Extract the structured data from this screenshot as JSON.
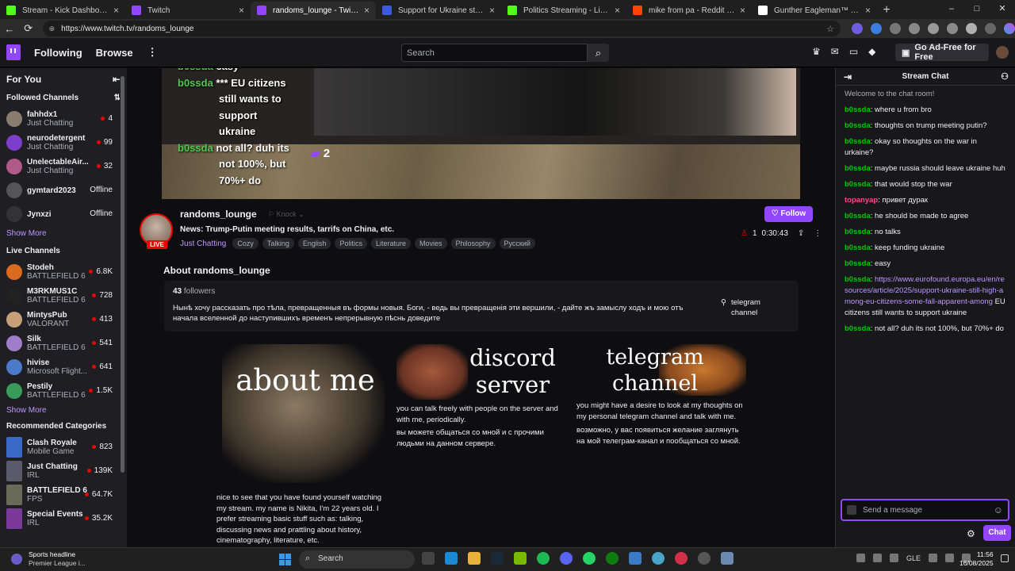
{
  "browser": {
    "tabs": [
      {
        "title": "Stream - Kick Dashboard",
        "color": "#53fc18"
      },
      {
        "title": "Twitch",
        "color": "#9147ff"
      },
      {
        "title": "randoms_lounge - Twitch",
        "color": "#9147ff"
      },
      {
        "title": "Support for Ukraine still high am",
        "color": "#3b5bdb"
      },
      {
        "title": "Politics Streaming - Live Streams",
        "color": "#53fc18"
      },
      {
        "title": "mike from pa - Reddit Search!",
        "color": "#ff4500"
      },
      {
        "title": "Gunther Eagleman™ (@Gunther",
        "color": "#ffffff"
      }
    ],
    "active_tab": 2,
    "url": "https://www.twitch.tv/randoms_lounge"
  },
  "topnav": {
    "following": "Following",
    "browse": "Browse",
    "search_placeholder": "Search",
    "adfree": "Go Ad-Free for Free"
  },
  "sidebar": {
    "for_you": "For You",
    "followed_header": "Followed Channels",
    "followed": [
      {
        "name": "fahhdx1",
        "game": "Just Chatting",
        "viewers": "4",
        "color": "#8a7d70"
      },
      {
        "name": "neurodetergent",
        "game": "Just Chatting",
        "viewers": "99",
        "color": "#7b3fc9"
      },
      {
        "name": "UnelectableAir...",
        "game": "Just Chatting",
        "viewers": "32",
        "color": "#b05a8a"
      },
      {
        "name": "gymtard2023",
        "game": "",
        "viewers": "Offline",
        "color": "#555"
      },
      {
        "name": "Jynxzi",
        "game": "",
        "viewers": "Offline",
        "color": "#333"
      }
    ],
    "show_more": "Show More",
    "live_header": "Live Channels",
    "live": [
      {
        "name": "Stodeh",
        "game": "BATTLEFIELD 6",
        "viewers": "6.8K",
        "color": "#d96a1e"
      },
      {
        "name": "M3RKMUS1C",
        "game": "BATTLEFIELD 6",
        "viewers": "728",
        "color": "#222"
      },
      {
        "name": "MintysPub",
        "game": "VALORANT",
        "viewers": "413",
        "color": "#c7a07a"
      },
      {
        "name": "Silk",
        "game": "BATTLEFIELD 6",
        "viewers": "541",
        "color": "#a07dc9"
      },
      {
        "name": "hivise",
        "game": "Microsoft Flight...",
        "viewers": "641",
        "color": "#4a7ac9"
      },
      {
        "name": "Pestily",
        "game": "BATTLEFIELD 6",
        "viewers": "1.5K",
        "color": "#3a9a5a"
      }
    ],
    "show_more2": "Show More",
    "rec_header": "Recommended Categories",
    "categories": [
      {
        "name": "Clash Royale",
        "tag": "Mobile Game",
        "viewers": "823",
        "color": "#3a6ac9"
      },
      {
        "name": "Just Chatting",
        "tag": "IRL",
        "viewers": "139K",
        "color": "#5a5a6a"
      },
      {
        "name": "BATTLEFIELD 6",
        "tag": "FPS",
        "viewers": "64.7K",
        "color": "#6a6a5a"
      },
      {
        "name": "Special Events",
        "tag": "IRL",
        "viewers": "35.2K",
        "color": "#7a3a9a"
      }
    ]
  },
  "video_overlay": {
    "lines": [
      {
        "user": "b0ssda",
        "text": "easy"
      },
      {
        "user": "b0ssda",
        "text": "*** EU citizens"
      },
      {
        "user": "",
        "text": "still wants to"
      },
      {
        "user": "",
        "text": "support"
      },
      {
        "user": "",
        "text": "ukraine"
      },
      {
        "user": "b0ssda",
        "text": "not all? duh its"
      },
      {
        "user": "",
        "text": "not 100%, but"
      },
      {
        "user": "",
        "text": "70%+ do"
      }
    ],
    "viewers_badge": "2"
  },
  "channel": {
    "name": "randoms_lounge",
    "knock": "Knock",
    "live": "LIVE",
    "title": "News: Trump-Putin meeting results, tarrifs on China, etc.",
    "category": "Just Chatting",
    "tags": [
      "Cozy",
      "Talking",
      "English",
      "Politics",
      "Literature",
      "Movies",
      "Philosophy",
      "Русский"
    ],
    "follow": "Follow",
    "viewers": "1",
    "uptime": "0:30:43"
  },
  "about": {
    "heading": "About randoms_lounge",
    "followers_count": "43",
    "followers_label": "followers",
    "bio": "Нынѣ хочу рассказать про тѣла, превращенныя въ формы новыя. Боги, - ведь вы превращенія эти вершили, - дайте жъ замыслу ходъ и мою отъ начала вселенной до наступившихъ временъ непрерывную пѣснь доведите",
    "link": "telegram channel"
  },
  "panels": {
    "p1": {
      "title": "about me",
      "text": "nice to see that you have found yourself watching my stream. my name is Nikita, I'm 22 years old. I prefer streaming basic stuff such as: talking, discussing news and prattling about history, cinematography, literature, etc."
    },
    "p2": {
      "title": "discord server",
      "text_en": "you can talk freely with people on the server and with me, periodically.",
      "text_ru": "вы можете общаться со мной и с прочими людьми на данном сервере."
    },
    "p3": {
      "title": "telegram channel",
      "text_en": "you might have a desire to look at my thoughts on my personal telegram channel and talk with me.",
      "text_ru": "возможно, у вас появиться желание заглянуть на мой телеграм-канал и пообщаться со мной."
    }
  },
  "chat": {
    "header": "Stream Chat",
    "welcome": "Welcome to the chat room!",
    "messages": [
      {
        "user": "b0ssda",
        "color": "#00c800",
        "text": "where u from bro"
      },
      {
        "user": "b0ssda",
        "color": "#00c800",
        "text": "thoughts on trump meeting putin?"
      },
      {
        "user": "b0ssda",
        "color": "#00c800",
        "text": "okay so thoughts on the war in urkaine?"
      },
      {
        "user": "b0ssda",
        "color": "#00c800",
        "text": "maybe russia should leave ukraine huh"
      },
      {
        "user": "b0ssda",
        "color": "#00c800",
        "text": "that would stop the war"
      },
      {
        "user": "topanyap",
        "color": "#ff4a8a",
        "text": "привет дурак"
      },
      {
        "user": "b0ssda",
        "color": "#00c800",
        "text": "he should be made to agree"
      },
      {
        "user": "b0ssda",
        "color": "#00c800",
        "text": "no talks"
      },
      {
        "user": "b0ssda",
        "color": "#00c800",
        "text": "keep funding ukraine"
      },
      {
        "user": "b0ssda",
        "color": "#00c800",
        "text": "easy"
      },
      {
        "user": "b0ssda",
        "color": "#00c800",
        "link": "https://www.eurofound.europa.eu/en/resources/article/2025/support-ukraine-still-high-among-eu-citizens-some-fall-apparent-among",
        "text": "EU citizens still wants to support ukraine"
      },
      {
        "user": "b0ssda",
        "color": "#00c800",
        "text": "not all? duh its not 100%, but 70%+ do"
      }
    ],
    "input_placeholder": "Send a message",
    "chat_button": "Chat"
  },
  "taskbar": {
    "news_title": "Sports headline",
    "news_sub": "Premier League i...",
    "search": "Search",
    "lang": "GLE",
    "time": "11:56",
    "date": "16/08/2025"
  }
}
